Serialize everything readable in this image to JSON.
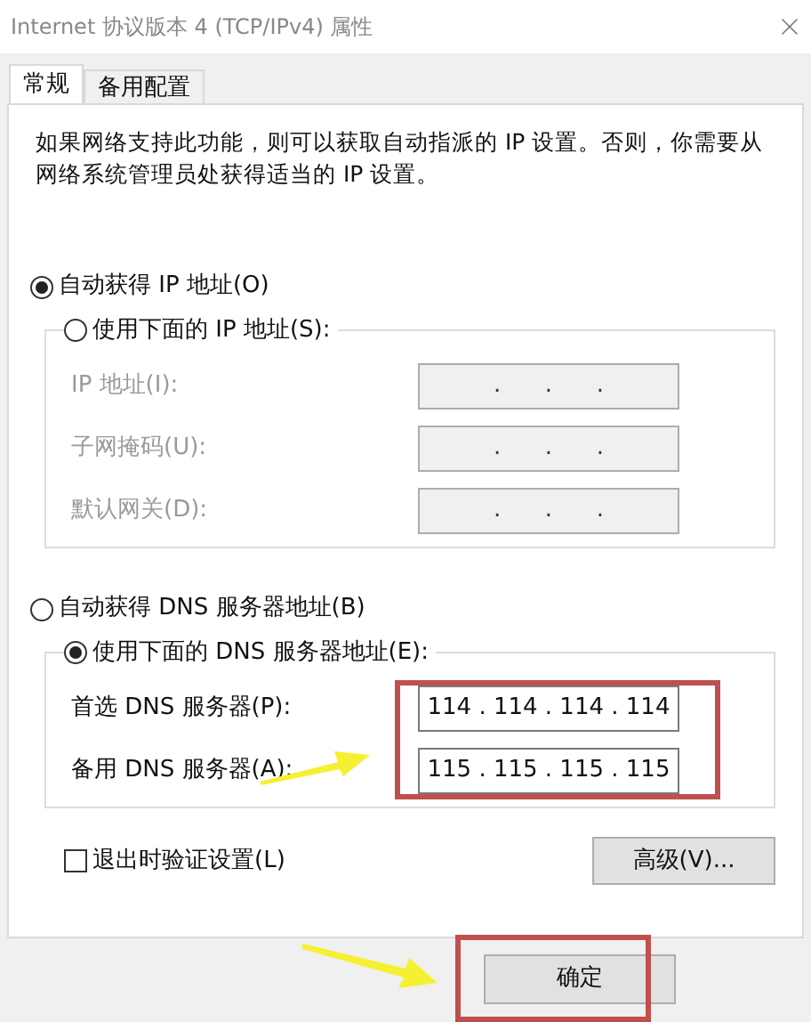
{
  "window": {
    "title": "Internet 协议版本 4 (TCP/IPv4) 属性"
  },
  "tabs": [
    {
      "label": "常规",
      "selected": true
    },
    {
      "label": "备用配置",
      "selected": false
    }
  ],
  "description": "如果网络支持此功能，则可以获取自动指派的 IP 设置。否则，你需要从网络系统管理员处获得适当的 IP 设置。",
  "ip_mode": [
    {
      "label": "自动获得 IP 地址(O)",
      "selected": true
    },
    {
      "label": "使用下面的 IP 地址(S):",
      "selected": false
    }
  ],
  "ip_fields": [
    {
      "label": "IP 地址(I):",
      "value": ".      .      .",
      "disabled": true
    },
    {
      "label": "子网掩码(U):",
      "value": ".      .      .",
      "disabled": true
    },
    {
      "label": "默认网关(D):",
      "value": ".      .      .",
      "disabled": true
    }
  ],
  "dns_mode": [
    {
      "label": "自动获得 DNS 服务器地址(B)",
      "selected": false
    },
    {
      "label": "使用下面的 DNS 服务器地址(E):",
      "selected": true
    }
  ],
  "dns_fields": [
    {
      "label": "首选 DNS 服务器(P):",
      "value": "114 . 114 . 114 . 114",
      "disabled": false
    },
    {
      "label": "备用 DNS 服务器(A):",
      "value": "115 . 115 . 115 . 115",
      "disabled": false
    }
  ],
  "validate_on_exit": {
    "label": "退出时验证设置(L)",
    "checked": false
  },
  "advanced_button": "高级(V)...",
  "ok_button": "确定"
}
